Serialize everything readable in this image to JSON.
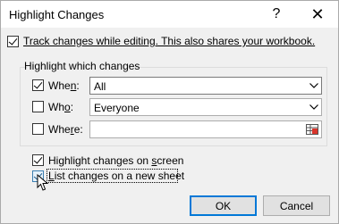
{
  "dialog": {
    "title": "Highlight Changes",
    "help_glyph": "?",
    "close_glyph": "✕"
  },
  "track_changes": {
    "checked": true,
    "label": "Track changes while editing. This also shares your workbook."
  },
  "group": {
    "label": "Highlight which changes"
  },
  "when": {
    "checked": true,
    "label_prefix": "Whe",
    "label_accel": "n",
    "label_suffix": ":",
    "value": "All"
  },
  "who": {
    "checked": false,
    "label_prefix": "Wh",
    "label_accel": "o",
    "label_suffix": ":",
    "value": "Everyone"
  },
  "where": {
    "checked": false,
    "label_prefix": "Whe",
    "label_accel": "r",
    "label_suffix": "e:",
    "value": ""
  },
  "highlight_on_screen": {
    "checked": true,
    "label_prefix": "Highlight changes on ",
    "label_accel": "s",
    "label_suffix": "creen"
  },
  "list_on_sheet": {
    "checked": true,
    "label_accel": "L",
    "label_suffix": "ist changes on a new sheet"
  },
  "buttons": {
    "ok_label": "OK",
    "cancel_label": "Cancel"
  }
}
